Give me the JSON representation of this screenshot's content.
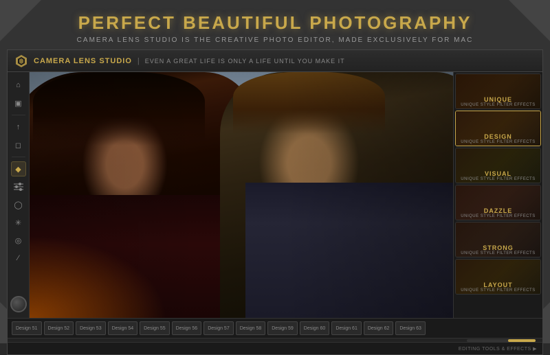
{
  "header": {
    "title": "PERFECT BEAUTIFUL PHOTOGRAPHY",
    "subtitle": "CAMERA LENS STUDIO IS THE CREATIVE PHOTO EDITOR, MADE EXCLUSIVELY FOR MAC"
  },
  "app": {
    "name": "CAMERA LENS STUDIO",
    "divider": "|",
    "tagline": "EVEN A GREAT LIFE IS ONLY A LIFE UNTIL YOU MAKE IT"
  },
  "toolbar": {
    "tools": [
      {
        "name": "home",
        "symbol": "⌂",
        "active": false
      },
      {
        "name": "image",
        "symbol": "▣",
        "active": false
      },
      {
        "name": "upload",
        "symbol": "↑",
        "active": false
      },
      {
        "name": "save",
        "symbol": "⬛",
        "active": false
      },
      {
        "name": "gem",
        "symbol": "◆",
        "active": true
      },
      {
        "name": "sliders",
        "symbol": "≡",
        "active": false
      },
      {
        "name": "bulb",
        "symbol": "◯",
        "active": false
      },
      {
        "name": "magic",
        "symbol": "✳",
        "active": false
      },
      {
        "name": "eye",
        "symbol": "◎",
        "active": false
      },
      {
        "name": "brush",
        "symbol": "/",
        "active": false
      }
    ]
  },
  "filters": [
    {
      "id": "unique",
      "name": "UNIQUE",
      "sub": "UNIQUE STYLE FILTER EFFECTS",
      "class": "fc-unique"
    },
    {
      "id": "design",
      "name": "DESIGN",
      "sub": "UNIQUE STYLE FILTER EFFECTS",
      "class": "fc-design",
      "active": true
    },
    {
      "id": "visual",
      "name": "VISUAL",
      "sub": "UNIQUE STYLE FILTER EFFECTS",
      "class": "fc-visual"
    },
    {
      "id": "dazzle",
      "name": "DAZZLE",
      "sub": "UNIQUE STYLE FILTER EFFECTS",
      "class": "fc-dazzle"
    },
    {
      "id": "strong",
      "name": "STRONG",
      "sub": "UNIQUE STYLE FILTER EFFECTS",
      "class": "fc-strong"
    },
    {
      "id": "layout",
      "name": "LAYOUT",
      "sub": "UNIQUE STYLE FILTER EFFECTS",
      "class": "fc-layout"
    }
  ],
  "designs": [
    {
      "label": "Design 51",
      "active": false
    },
    {
      "label": "Design 52",
      "active": false
    },
    {
      "label": "Design 53",
      "active": false
    },
    {
      "label": "Design 54",
      "active": false
    },
    {
      "label": "Design 55",
      "active": false
    },
    {
      "label": "Design 56",
      "active": false
    },
    {
      "label": "Design 57",
      "active": false
    },
    {
      "label": "Design 58",
      "active": false
    },
    {
      "label": "Design 59",
      "active": false
    },
    {
      "label": "Design 60",
      "active": false
    },
    {
      "label": "Design 61",
      "active": false
    },
    {
      "label": "Design 62",
      "active": false
    },
    {
      "label": "Design 63",
      "active": false
    }
  ],
  "status": {
    "text": "EDITING TOOLS & EFFECTS ▶"
  },
  "colors": {
    "accent": "#c8a84b",
    "bg_dark": "#1a1a1a",
    "bg_medium": "#2a2a2a"
  }
}
